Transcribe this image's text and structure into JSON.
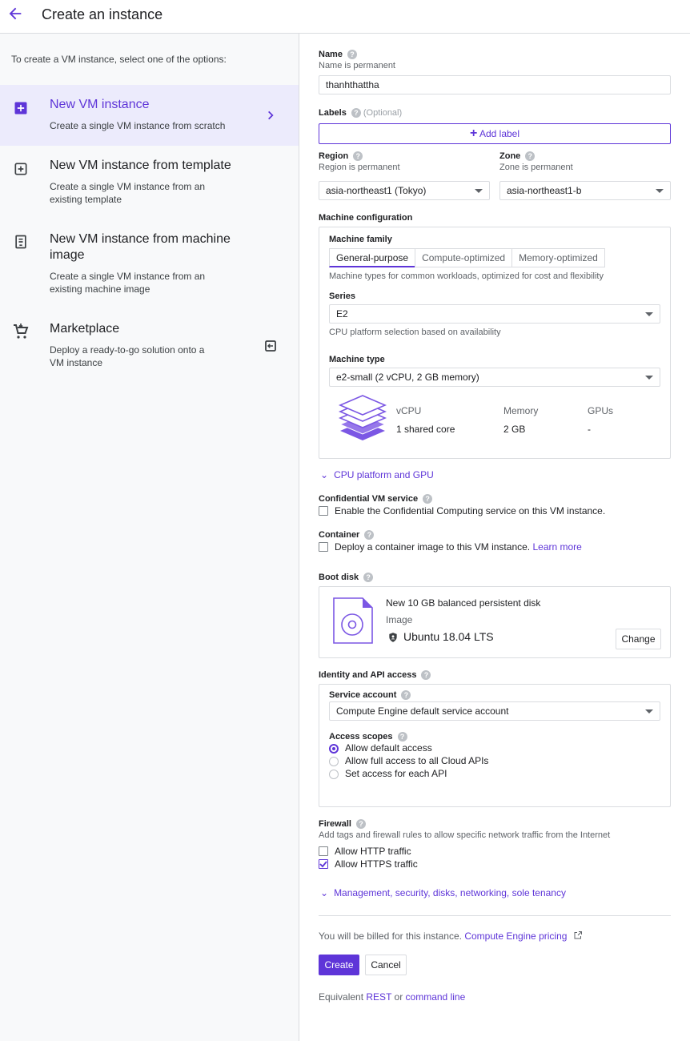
{
  "header": {
    "title": "Create an instance"
  },
  "left": {
    "intro": "To create a VM instance, select one of the options:",
    "options": [
      {
        "title": "New VM instance",
        "desc": "Create a single VM instance from scratch",
        "selected": true
      },
      {
        "title": "New VM instance from template",
        "desc": "Create a single VM instance from an existing template"
      },
      {
        "title": "New VM instance from machine image",
        "desc": "Create a single VM instance from an existing machine image"
      },
      {
        "title": "Marketplace",
        "desc": "Deploy a ready-to-go solution onto a VM instance"
      }
    ]
  },
  "form": {
    "name_label": "Name",
    "name_sub": "Name is permanent",
    "name_value": "thanhthattha",
    "labels_label": "Labels",
    "labels_optional": "(Optional)",
    "add_label": "Add label",
    "region_label": "Region",
    "region_sub": "Region is permanent",
    "region_value": "asia-northeast1 (Tokyo)",
    "zone_label": "Zone",
    "zone_sub": "Zone is permanent",
    "zone_value": "asia-northeast1-b",
    "machine_config_label": "Machine configuration",
    "machine_family_label": "Machine family",
    "family_tabs": [
      "General-purpose",
      "Compute-optimized",
      "Memory-optimized"
    ],
    "family_desc": "Machine types for common workloads, optimized for cost and flexibility",
    "series_label": "Series",
    "series_value": "E2",
    "series_desc": "CPU platform selection based on availability",
    "machine_type_label": "Machine type",
    "machine_type_value": "e2-small (2 vCPU, 2 GB memory)",
    "specs": {
      "vcpu_label": "vCPU",
      "vcpu_value": "1 shared core",
      "memory_label": "Memory",
      "memory_value": "2 GB",
      "gpus_label": "GPUs",
      "gpus_value": "-"
    },
    "cpu_platform_link": "CPU platform and GPU",
    "confidential_label": "Confidential VM service",
    "confidential_text": "Enable the Confidential Computing service on this VM instance.",
    "container_label": "Container",
    "container_text": "Deploy a container image to this VM instance.",
    "learn_more": "Learn more",
    "boot_disk_label": "Boot disk",
    "boot_disk_title": "New 10 GB balanced persistent disk",
    "boot_disk_image_label": "Image",
    "boot_disk_image": "Ubuntu 18.04 LTS",
    "change_button": "Change",
    "identity_label": "Identity and API access",
    "service_account_label": "Service account",
    "service_account_value": "Compute Engine default service account",
    "access_scopes_label": "Access scopes",
    "scopes": [
      "Allow default access",
      "Allow full access to all Cloud APIs",
      "Set access for each API"
    ],
    "firewall_label": "Firewall",
    "firewall_desc": "Add tags and firewall rules to allow specific network traffic from the Internet",
    "http_label": "Allow HTTP traffic",
    "https_label": "Allow HTTPS traffic",
    "management_link": "Management, security, disks, networking, sole tenancy",
    "billing_text": "You will be billed for this instance.",
    "pricing_link": "Compute Engine pricing",
    "create_button": "Create",
    "cancel_button": "Cancel",
    "equivalent_text": "Equivalent",
    "rest_link": "REST",
    "or_text": "or",
    "command_line_link": "command line"
  },
  "colors": {
    "accent": "#5e35d8"
  }
}
